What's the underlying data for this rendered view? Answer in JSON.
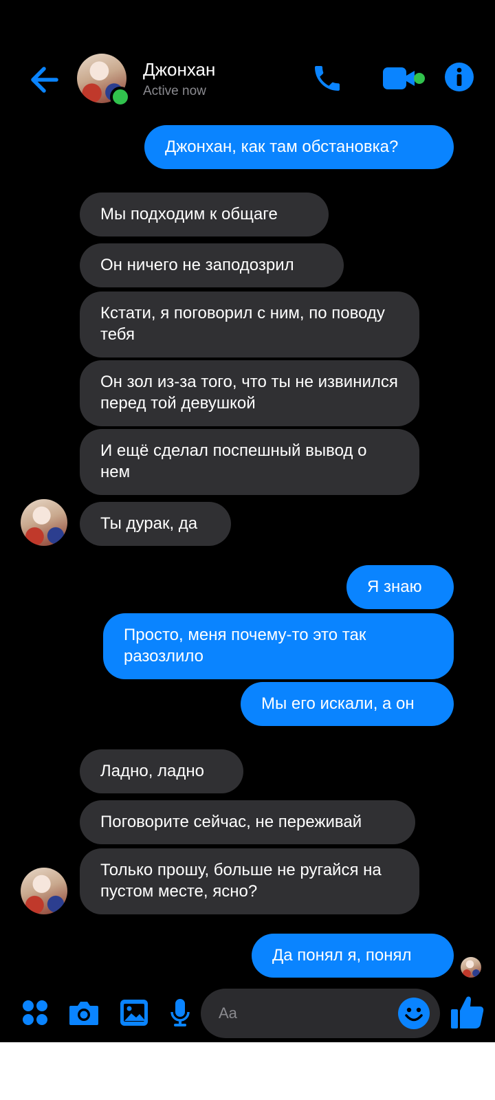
{
  "header": {
    "contact_name": "Джонхан",
    "status": "Active now"
  },
  "messages": [
    {
      "side": "out",
      "text": "Джонхан, как там обстановка?"
    },
    {
      "side": "in",
      "text": "Мы подходим к общаге"
    },
    {
      "side": "in",
      "text": "Он ничего не заподозрил"
    },
    {
      "side": "in",
      "text": "Кстати, я поговорил с ним, по поводу тебя"
    },
    {
      "side": "in",
      "text": "Он зол из-за того, что ты не извинился перед той девушкой"
    },
    {
      "side": "in",
      "text": "И ещё сделал поспешный вывод о нем"
    },
    {
      "side": "in",
      "text": "Ты дурак, да"
    },
    {
      "side": "out",
      "text": "Я знаю"
    },
    {
      "side": "out",
      "text": "Просто, меня почему-то это так разозлило"
    },
    {
      "side": "out",
      "text": "Мы его искали, а он"
    },
    {
      "side": "in",
      "text": "Ладно, ладно"
    },
    {
      "side": "in",
      "text": "Поговорите сейчас, не переживай"
    },
    {
      "side": "in",
      "text": "Только прошу, больше не ругайся на пустом месте, ясно?"
    },
    {
      "side": "out",
      "text": "Да понял я, понял"
    }
  ],
  "composer": {
    "placeholder": "Aa"
  },
  "icons": {
    "back": "arrow-left-icon",
    "call": "phone-icon",
    "video": "video-camera-icon",
    "info": "info-icon",
    "apps": "grid-icon",
    "camera": "camera-icon",
    "gallery": "image-icon",
    "voice": "microphone-icon",
    "emoji": "smiley-icon",
    "like": "thumbs-up-icon"
  },
  "colors": {
    "accent": "#0a84ff",
    "incoming_bubble": "#303033",
    "online": "#31c24d",
    "background": "#000000"
  }
}
